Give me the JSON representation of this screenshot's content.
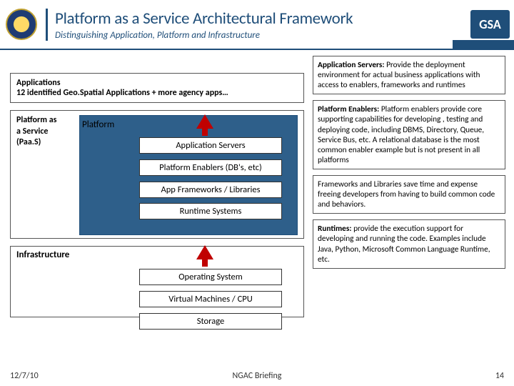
{
  "header": {
    "title": "Platform as a Service Architectural Framework",
    "subtitle": "Distinguishing Application, Platform and Infrastructure",
    "gsa": "GSA"
  },
  "applications_box": {
    "line1": "Applications",
    "line2": "12 identified Geo.Spatial Applications + more agency apps…"
  },
  "paas": {
    "label_line1": "Platform as",
    "label_line2": "a Service",
    "label_line3": "(Paa.S)",
    "inner_label": "Platform"
  },
  "stack": {
    "app_servers": "Application Servers",
    "enablers": "Platform Enablers (DB's, etc)",
    "frameworks": "App Frameworks / Libraries",
    "runtimes": "Runtime Systems",
    "os": "Operating System",
    "vmcpu": "Virtual Machines / CPU",
    "storage": "Storage"
  },
  "infrastructure_label": "Infrastructure",
  "notes": {
    "n1": {
      "bold": "Application Servers: ",
      "text": "Provide the deployment environment for actual business applications with access to enablers, frameworks and runtimes"
    },
    "n2": {
      "bold": "Platform Enablers: ",
      "text": "Platform enablers provide core supporting capabilities for developing , testing and deploying code, including DBMS, Directory, Queue, Service Bus, etc.  A relational database is the most common enabler example but is not present in all platforms"
    },
    "n3": {
      "bold": "",
      "text": "Frameworks and Libraries save time and expense freeing developers from having to build common code and behaviors."
    },
    "n4": {
      "bold": "Runtimes: ",
      "text": "provide the execution support for developing and running the code.  Examples include Java, Python, Microsoft Common Language Runtime, etc."
    }
  },
  "footer": {
    "date": "12/7/10",
    "center": "NGAC Briefing",
    "page": "14"
  }
}
